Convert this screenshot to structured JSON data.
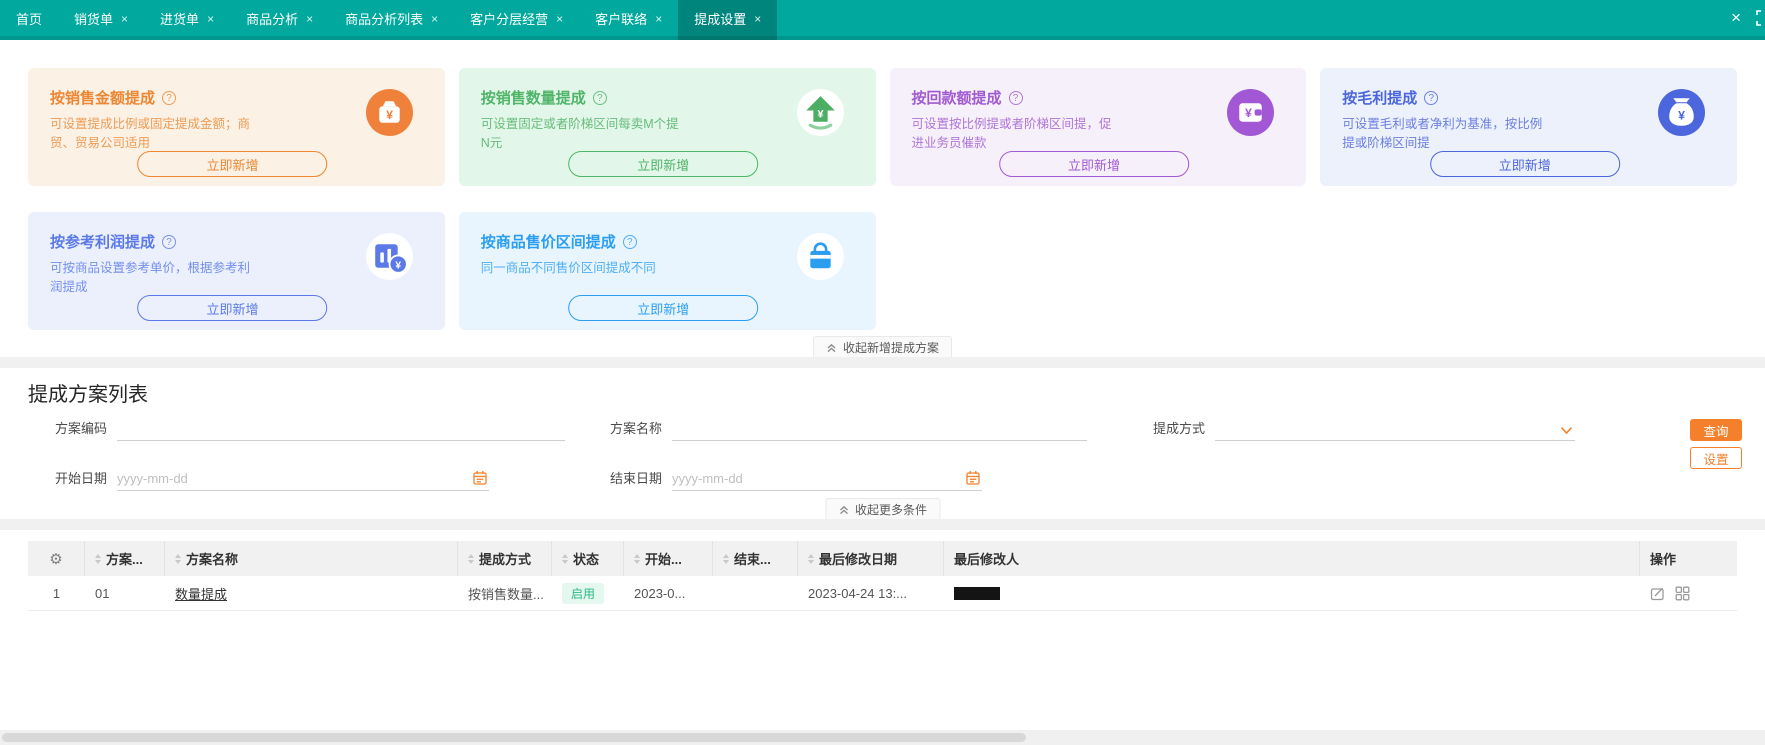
{
  "colors": {
    "tabbar": "#00a89d",
    "tabbar_active": "#00857c",
    "primary_orange": "#f5802c",
    "card_orange": "#ed8733",
    "card_green": "#4fb567",
    "card_purple": "#a25ad2",
    "card_blue": "#4c66dd",
    "card_indigo": "#5b7ae8",
    "card_cyan": "#2c9ef2",
    "status_enabled_bg": "#e5f8f0",
    "status_enabled_text": "#2fb886"
  },
  "tabbar": {
    "close_all": "×",
    "tabs": [
      {
        "label": "首页",
        "close": ""
      },
      {
        "label": "销货单",
        "close": "×"
      },
      {
        "label": "进货单",
        "close": "×"
      },
      {
        "label": "商品分析",
        "close": "×"
      },
      {
        "label": "商品分析列表",
        "close": "×"
      },
      {
        "label": "客户分层经营",
        "close": "×"
      },
      {
        "label": "客户联络",
        "close": "×"
      },
      {
        "label": "提成设置",
        "close": "×"
      }
    ]
  },
  "cards": {
    "collapse_label": "收起新增提成方案",
    "items": [
      {
        "title": "按销售金额提成",
        "desc": "可设置提成比例或固定提成金额；商\n贸、贸易公司适用",
        "button": "立即新增",
        "icon": "money-pouch-icon"
      },
      {
        "title": "按销售数量提成",
        "desc": "可设置固定或者阶梯区间每卖M个提\nN元",
        "button": "立即新增",
        "icon": "arrow-up-yuan-icon"
      },
      {
        "title": "按回款额提成",
        "desc": "可设置按比例提或者阶梯区间提，促\n进业务员催款",
        "button": "立即新增",
        "icon": "wallet-yuan-icon"
      },
      {
        "title": "按毛利提成",
        "desc": "可设置毛利或者净利为基准，按比例\n提或阶梯区间提",
        "button": "立即新增",
        "icon": "money-bag-icon"
      },
      {
        "title": "按参考利润提成",
        "desc": "可按商品设置参考单价，根据参考利\n润提成",
        "button": "立即新增",
        "icon": "chart-coin-icon"
      },
      {
        "title": "按商品售价区间提成",
        "desc": "同一商品不同售价区间提成不同",
        "button": "立即新增",
        "icon": "shopping-bag-icon"
      }
    ]
  },
  "plan_list": {
    "title": "提成方案列表",
    "filters": {
      "code_label": "方案编码",
      "name_label": "方案名称",
      "method_label": "提成方式",
      "start_label": "开始日期",
      "end_label": "结束日期",
      "date_placeholder": "yyyy-mm-dd",
      "search_button": "查询",
      "settings_button": "设置",
      "collapse_label": "收起更多条件"
    },
    "table": {
      "headers": [
        "方案...",
        "方案名称",
        "提成方式",
        "状态",
        "开始...",
        "结束...",
        "最后修改日期",
        "最后修改人",
        "操作"
      ],
      "row": {
        "index": "1",
        "code": "01",
        "name": "数量提成",
        "method": "按销售数量...",
        "status": "启用",
        "start": "2023-0...",
        "end": "",
        "modified_date": "2023-04-24 13:..."
      }
    }
  }
}
